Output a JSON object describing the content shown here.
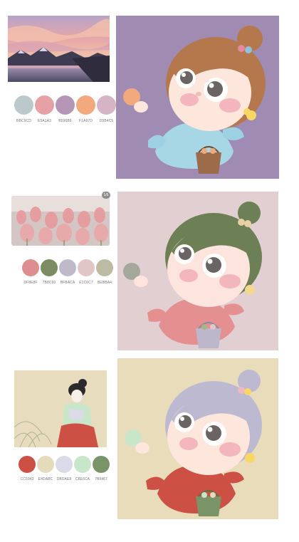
{
  "sections": [
    {
      "photo_subject": "landscape",
      "palette": [
        {
          "hex": "#BBC9CD",
          "code": "BBC9CD"
        },
        {
          "hex": "#E5A1A3",
          "code": "E5A1A3"
        },
        {
          "hex": "#B596B6",
          "code": "B596B6"
        },
        {
          "hex": "#F1A97D",
          "code": "F1A97D"
        },
        {
          "hex": "#D5B4C5",
          "code": "D5B4C5"
        }
      ],
      "art_bg": "#a08bb3"
    },
    {
      "photo_subject": "tulips",
      "badge": "1/6",
      "palette": [
        {
          "hex": "#DF8E8F",
          "code": "DF8E8F"
        },
        {
          "hex": "#7B8C60",
          "code": "7B8C60"
        },
        {
          "hex": "#BFBACA",
          "code": "BFBACA"
        },
        {
          "hex": "#E1C6C7",
          "code": "E1C6C7"
        },
        {
          "hex": "#BEBBA4",
          "code": "BEBBA4"
        }
      ],
      "art_bg": "#e2cfd2"
    },
    {
      "photo_subject": "ukiyo-e-woman",
      "palette": [
        {
          "hex": "#CC5043",
          "code": "CC5043"
        },
        {
          "hex": "#E4DABC",
          "code": "E4DABC"
        },
        {
          "hex": "#DBDAE8",
          "code": "DBDAE8"
        },
        {
          "hex": "#C8E6CA",
          "code": "C8E6CA"
        },
        {
          "hex": "#7B9467",
          "code": "7B9467"
        }
      ],
      "art_bg": "#e8dcbb"
    }
  ]
}
